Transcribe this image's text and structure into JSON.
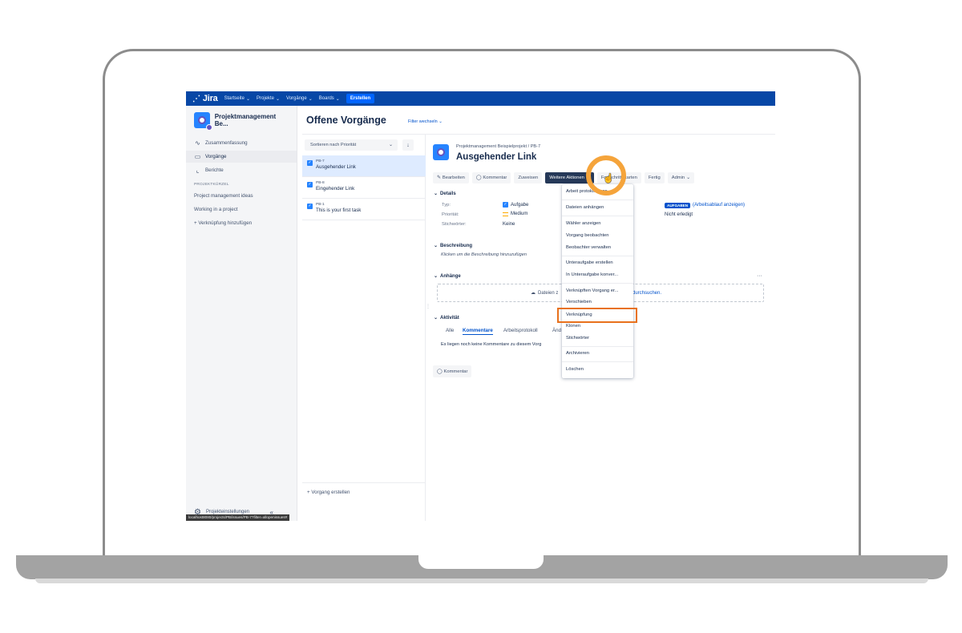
{
  "topnav": {
    "logo": "Jira",
    "items": [
      "Startseite",
      "Projekte",
      "Vorgänge",
      "Boards"
    ],
    "create": "Erstellen"
  },
  "sidebar": {
    "project_name": "Projektmanagement Be...",
    "items": [
      {
        "label": "Zusammenfassung",
        "icon": "activity-icon"
      },
      {
        "label": "Vorgänge",
        "icon": "issues-icon"
      },
      {
        "label": "Berichte",
        "icon": "chart-icon"
      }
    ],
    "section_label": "PROJEKTKÜRZEL",
    "links": [
      "Project management ideas",
      "Working in a project",
      "+ Verknüpfung hinzufügen"
    ],
    "footer": "Projekteinstellungen",
    "collapse": "«",
    "status_url": "localhost8080/projects/PB/issues/PB-7?filter=allopenissues#"
  },
  "main": {
    "title": "Offene Vorgänge",
    "filter_switch": "Filter wechseln",
    "sort_label": "Sortieren nach Priorität",
    "issues": [
      {
        "key": "PB-7",
        "summary": "Ausgehender Link"
      },
      {
        "key": "PB-8",
        "summary": "Eingehender Link"
      },
      {
        "key": "PB-1",
        "summary": "This is your first task"
      }
    ],
    "create_issue": "+ Vorgang erstellen"
  },
  "detail": {
    "breadcrumb_project": "Projektmanagement Beispielprojekt",
    "breadcrumb_sep": "/",
    "breadcrumb_key": "PB-7",
    "title": "Ausgehender Link",
    "toolbar": {
      "edit": "Bearbeiten",
      "comment": "Kommentar",
      "assign": "Zuweisen",
      "more": "Weitere Aktionen",
      "start": "Fortschritt starten",
      "done": "Fertig",
      "admin": "Admin"
    },
    "details_head": "Details",
    "type_label": "Typ:",
    "type_value": "Aufgabe",
    "priority_label": "Priorität:",
    "priority_value": "Medium",
    "labels_label": "Stichwörter:",
    "labels_value": "Keine",
    "status": "AUFGABEN",
    "workflow_link": "(Arbeitsablauf anzeigen)",
    "resolution": "Nicht erledigt",
    "description_head": "Beschreibung",
    "description_placeholder": "Klicken um die Beschreibung hinzuzufügen",
    "attachments_head": "Anhänge",
    "attachments_more": "···",
    "drop_text": "Dateien z",
    "drop_browse": "durchsuchen.",
    "activity_head": "Aktivität",
    "tabs": [
      "Alle",
      "Kommentare",
      "Arbeitsprotokoll",
      "Änd"
    ],
    "no_comments": "Es liegen noch keine Kommentare zu diesem Vorg",
    "comment_button": "Kommentar"
  },
  "dropdown": {
    "items": [
      "Arbeit protokollieren",
      "Dateien anhängen",
      "Wähler anzeigen",
      "Vorgang beobachten",
      "Beobachter verwalten",
      "Unteraufgabe erstellen",
      "In Unteraufgabe konver...",
      "Verknüpften Vorgang er...",
      "Verschieben",
      "Verknüpfung",
      "Klonen",
      "Stichwörter",
      "Archivieren",
      "Löschen"
    ]
  },
  "colors": {
    "nav": "#0747a6",
    "accent": "#0052cc",
    "highlight": "#e8711c",
    "ring": "#f5a43b"
  }
}
